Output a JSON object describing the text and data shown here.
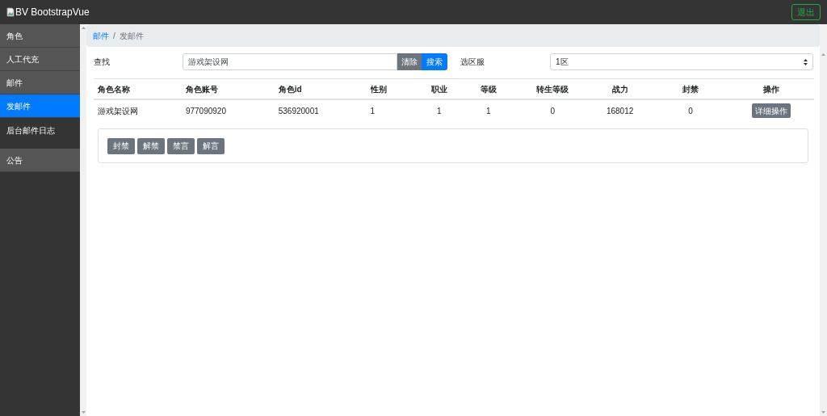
{
  "navbar": {
    "brand": "BV BootstrapVue",
    "logout": "退出"
  },
  "sidebar": {
    "items": [
      {
        "label": "角色",
        "kind": "panel",
        "selected": false
      },
      {
        "label": "人工代充",
        "kind": "panel",
        "selected": false
      },
      {
        "label": "邮件",
        "kind": "panel",
        "selected": false
      },
      {
        "label": "发邮件",
        "kind": "panel",
        "selected": true
      },
      {
        "label": "后台邮件日志",
        "kind": "plain",
        "selected": false
      },
      {
        "label": "公告",
        "kind": "panel",
        "selected": false
      }
    ]
  },
  "breadcrumb": {
    "separator": "/",
    "items": [
      {
        "label": "邮件",
        "kind": "link"
      },
      {
        "label": "发邮件",
        "kind": "current"
      }
    ]
  },
  "search": {
    "label": "查找",
    "value": "游戏架设网",
    "clear": "清除",
    "submit": "搜索"
  },
  "server": {
    "label": "选区服",
    "value": "1区"
  },
  "table": {
    "columns": [
      "角色名称",
      "角色账号",
      "角色id",
      "性别",
      "职业",
      "等级",
      "转生等级",
      "战力",
      "封禁",
      "操作"
    ],
    "rows": [
      {
        "cells": [
          "游戏架设网",
          "977090920",
          "536920001",
          "1",
          "1",
          "1",
          "0",
          "168012",
          "0"
        ],
        "action": "详细操作"
      }
    ]
  },
  "actions": [
    "封禁",
    "解禁",
    "禁言",
    "解言"
  ]
}
